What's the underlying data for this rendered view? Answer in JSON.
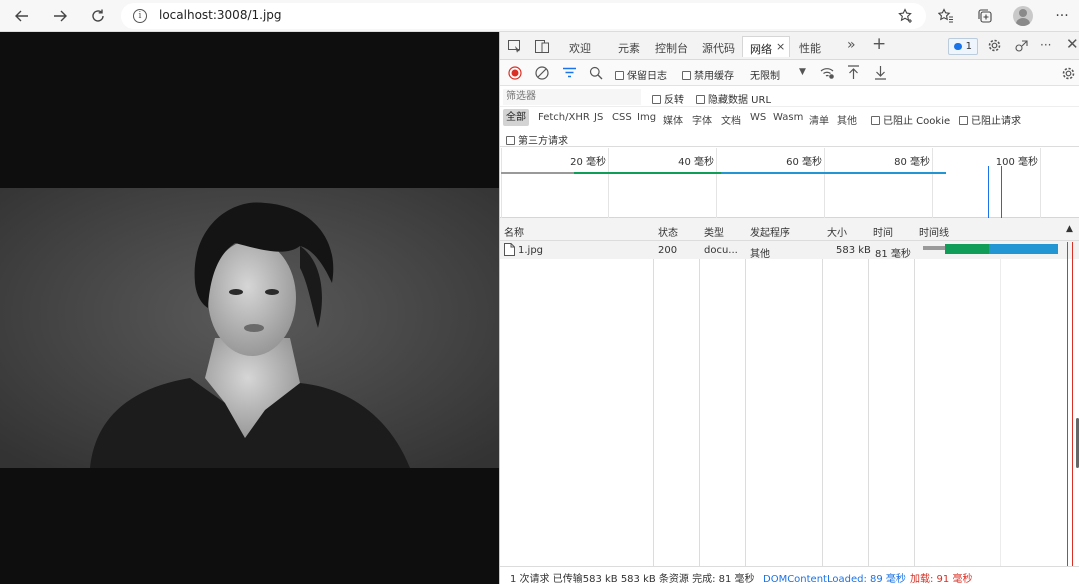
{
  "browser": {
    "url": "localhost:3008/1.jpg",
    "more_label": "···"
  },
  "devtools": {
    "tabs": [
      "欢迎",
      "元素",
      "控制台",
      "源代码",
      "网络",
      "性能"
    ],
    "active_tab": "网络",
    "issues_count": "1",
    "more_label": "···",
    "toolbar": {
      "preserve_log": "保留日志",
      "disable_cache": "禁用缓存",
      "throttle": "无限制"
    },
    "filter": {
      "placeholder": "筛选器",
      "invert": "反转",
      "hide_data_urls": "隐藏数据 URL"
    },
    "types": [
      "全部",
      "Fetch/XHR",
      "JS",
      "CSS",
      "Img",
      "媒体",
      "字体",
      "文档",
      "WS",
      "Wasm",
      "清单",
      "其他"
    ],
    "blocked_cookies": "已阻止 Cookie",
    "blocked_requests": "已阻止请求",
    "third_party": "第三方请求",
    "overview_ticks": [
      "20 毫秒",
      "40 毫秒",
      "60 毫秒",
      "80 毫秒",
      "100 毫秒"
    ],
    "columns": [
      "名称",
      "状态",
      "类型",
      "发起程序",
      "大小",
      "时间",
      "时间线"
    ],
    "rows": [
      {
        "name": "1.jpg",
        "status": "200",
        "type": "docu...",
        "initiator": "其他",
        "size": "583 kB",
        "time": "81 毫秒"
      }
    ],
    "status_bar": {
      "summary": "1 次请求 已传输583 kB 583 kB 条资源 完成: 81 毫秒",
      "dcl": "DOMContentLoaded: 89 毫秒",
      "load": "加载: 91 毫秒"
    },
    "colors": {
      "record": "#d93025",
      "filter_icon": "#1a73e8",
      "waiting": "#0f9d58",
      "download": "#2196d3",
      "dcl_line": "#1a73e8",
      "load_line": "#d93025"
    }
  }
}
